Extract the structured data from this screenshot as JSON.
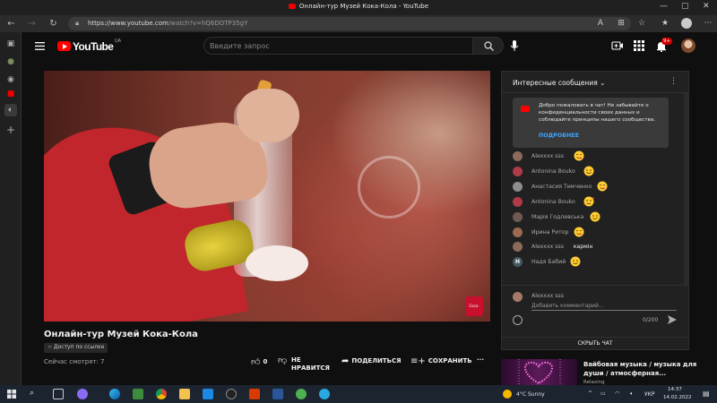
{
  "browser": {
    "tab_title": "Онлайн-тур Музей Кока-Кола - YouTube",
    "url_host": "https://www.youtube.com",
    "url_path": "/watch?v=hQ6DOTP35gY"
  },
  "youtube": {
    "logo_text": "YouTube",
    "country_code": "UA",
    "search_placeholder": "Введите запрос",
    "notification_count": "9+"
  },
  "video": {
    "title": "Онлайн-тур Музей Кока-Кола",
    "access_label": "Доступ по ссылке",
    "watching_now": "Сейчас смотрят: 7",
    "like_count": "0",
    "dislike_label_line1": "НЕ",
    "dislike_label_line2": "НРАВИТСЯ",
    "share_label": "ПОДЕЛИТЬСЯ",
    "save_label": "СОХРАНИТЬ",
    "more_label": "···"
  },
  "chat": {
    "header_title": "Интересные сообщения",
    "welcome_text": "Добро пожаловать в чат! Не забывайте о конфиденциальности своих данных и соблюдайте принципы нашего сообщества.",
    "welcome_more": "ПОДРОБНЕЕ",
    "messages": [
      {
        "author": "Alexxxx sss",
        "text": "",
        "emoji": "yum",
        "avatar_color": "#8a6a5a"
      },
      {
        "author": "Antonina Bouko",
        "text": "",
        "emoji": "smile",
        "avatar_color": "#b03a48"
      },
      {
        "author": "Анастасия Тимченко",
        "text": "",
        "emoji": "yum",
        "avatar_color": "#8d8d8d"
      },
      {
        "author": "Antonina Bouko",
        "text": "",
        "emoji": "hearts",
        "avatar_color": "#b03a48"
      },
      {
        "author": "Марія Годлевська",
        "text": "",
        "emoji": "smile",
        "avatar_color": "#6e5a50"
      },
      {
        "author": "Ирина Ритор",
        "text": "",
        "emoji": "yum",
        "avatar_color": "#9a6b50"
      },
      {
        "author": "Alexxxx sss",
        "text": "кармін",
        "emoji": "",
        "avatar_color": "#8a6a5a"
      },
      {
        "author": "Надя Бабий",
        "text": "",
        "emoji": "smile",
        "avatar_color": "#455a64",
        "avatar_letter": "Н"
      }
    ],
    "input_author": "Alexxxx sss",
    "input_placeholder": "Добавить комментарий...",
    "char_count": "0/200",
    "hide_chat": "СКРЫТЬ ЧАТ"
  },
  "recommendation": {
    "title": "Вайбовая музыка / музыка для души / атмосферная...",
    "channel": "Relaxing"
  },
  "taskbar": {
    "weather_temp": "4°C",
    "weather_desc": "Sunny",
    "language": "УКР",
    "time": "14:37",
    "date": "14.02.2022"
  },
  "video_badge": "Coca-Cola"
}
